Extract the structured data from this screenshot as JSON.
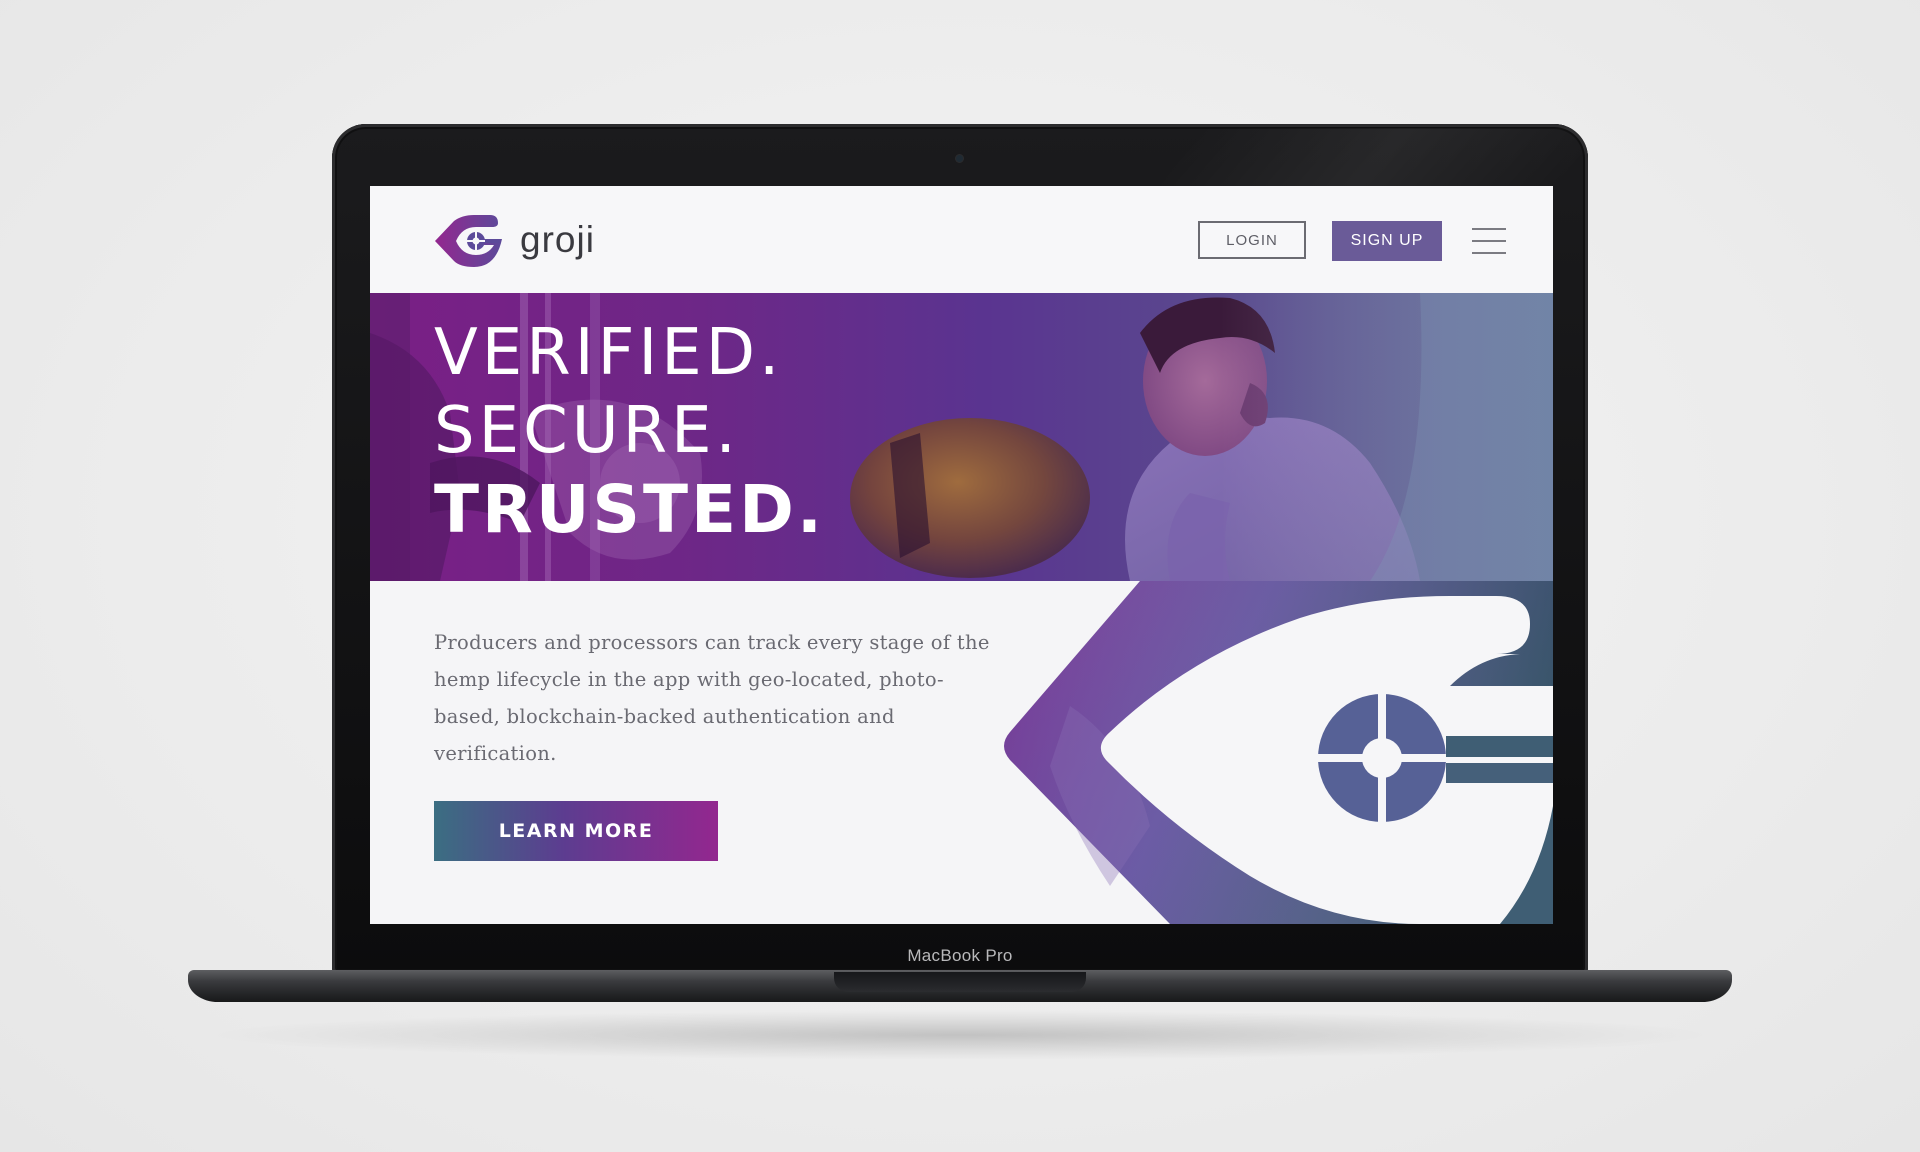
{
  "device": {
    "label": "MacBook Pro"
  },
  "site": {
    "brand": "groji",
    "nav": {
      "login_label": "LOGIN",
      "signup_label": "SIGN UP",
      "menu_icon": "hamburger-menu-icon"
    },
    "hero": {
      "line1": "VERIFIED.",
      "line2": "SECURE.",
      "line3": "TRUSTED."
    },
    "intro": {
      "text": "Producers and processors can track every stage of the hemp lifecycle in the app with geo-located, photo-based, blockchain-backed authentication and verification."
    },
    "cta": {
      "label": "LEARN MORE"
    }
  },
  "colors": {
    "brand_purple": "#93278f",
    "brand_violet": "#6a5b98",
    "brand_teal": "#3b6e82",
    "text_gray": "#6a6a72"
  }
}
